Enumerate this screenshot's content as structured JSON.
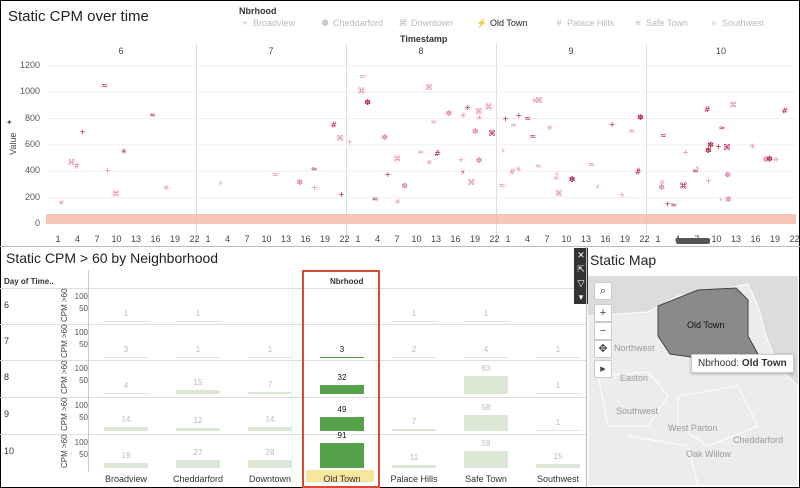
{
  "top_panel": {
    "title": "Static CPM over time",
    "legend_title": "Nbrhood",
    "legend": [
      {
        "label": "Broadview",
        "symbol": "+",
        "active": false
      },
      {
        "label": "Cheddarford",
        "symbol": "✽",
        "active": false
      },
      {
        "label": "Downtown",
        "symbol": "⌘",
        "active": false
      },
      {
        "label": "Old Town",
        "symbol": "⚡",
        "active": true
      },
      {
        "label": "Palace Hills",
        "symbol": "#",
        "active": false
      },
      {
        "label": "Safe Town",
        "symbol": "✳",
        "active": false
      },
      {
        "label": "Southwest",
        "symbol": "≈",
        "active": false
      }
    ],
    "x_title": "Timestamp",
    "y_title": "Value",
    "columns": [
      "6",
      "7",
      "8",
      "9",
      "10"
    ],
    "y_ticks": [
      "1200",
      "1000",
      "800",
      "600",
      "400",
      "200",
      "0"
    ],
    "x_ticks": [
      "1",
      "4",
      "7",
      "10",
      "13",
      "16",
      "19",
      "22"
    ]
  },
  "heat_panel": {
    "title": "Static CPM > 60 by Neighborhood",
    "row_header": "Day of Time..",
    "col_header": "Nbrhood",
    "axis_label": "CPM >60",
    "ticks": [
      "100",
      "50"
    ],
    "rows": [
      {
        "day": "6",
        "values": [
          "1",
          "1",
          "",
          "",
          "1",
          "1",
          ""
        ]
      },
      {
        "day": "7",
        "values": [
          "3",
          "1",
          "1",
          "3",
          "2",
          "4",
          "1"
        ]
      },
      {
        "day": "8",
        "values": [
          "4",
          "15",
          "7",
          "32",
          "",
          "63",
          "1"
        ]
      },
      {
        "day": "9",
        "values": [
          "14",
          "12",
          "14",
          "49",
          "7",
          "58",
          "1"
        ]
      },
      {
        "day": "10",
        "values": [
          "19",
          "27",
          "28",
          "91",
          "11",
          "59",
          "15"
        ]
      }
    ],
    "numbers": [
      [
        1,
        1,
        0,
        0,
        1,
        1,
        0
      ],
      [
        3,
        1,
        1,
        3,
        2,
        4,
        1
      ],
      [
        4,
        15,
        7,
        32,
        0,
        63,
        1
      ],
      [
        14,
        12,
        14,
        49,
        7,
        58,
        1
      ],
      [
        19,
        27,
        28,
        91,
        11,
        59,
        15
      ]
    ],
    "categories": [
      "Broadview",
      "Cheddarford",
      "Downtown",
      "Old Town",
      "Palace Hills",
      "Safe Town",
      "Southwest"
    ],
    "highlight_color": "#e8452f",
    "highlight_bar": "#56a24a",
    "muted_bar": "#dbe8d6"
  },
  "map_panel": {
    "title": "Static Map",
    "selected_label": "Old Town",
    "tooltip_key": "Nbrhood:",
    "tooltip_value": "Old Town",
    "labels": [
      "Northwest",
      "Easton",
      "Southwest",
      "West Parton",
      "Cheddarford",
      "Oak Willow"
    ]
  }
}
